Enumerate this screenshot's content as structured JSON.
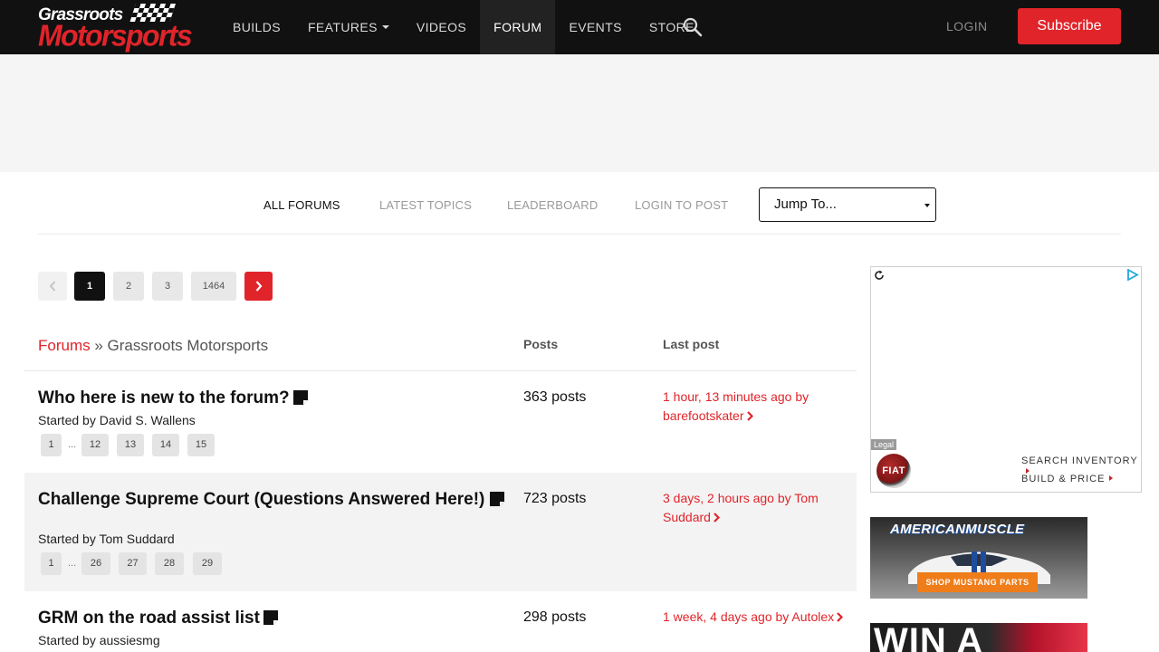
{
  "site": {
    "logo_line1": "Grassroots",
    "logo_line2": "Motorsports"
  },
  "nav": {
    "items": [
      {
        "label": "BUILDS"
      },
      {
        "label": "FEATURES"
      },
      {
        "label": "VIDEOS"
      },
      {
        "label": "FORUM"
      },
      {
        "label": "EVENTS"
      },
      {
        "label": "STORE"
      }
    ],
    "login_label": "LOGIN",
    "subscribe_label": "Subscribe"
  },
  "forum_nav": {
    "all_forums": "ALL FORUMS",
    "latest_topics": "LATEST TOPICS",
    "leaderboard": "LEADERBOARD",
    "login_to_post": "LOGIN TO POST",
    "jump_to": "Jump To..."
  },
  "pagination": {
    "pages": [
      "1",
      "2",
      "3",
      "1464"
    ],
    "current": "1"
  },
  "table": {
    "breadcrumb_link": "Forums",
    "breadcrumb_sep": " » ",
    "breadcrumb_current": "Grassroots Motorsports",
    "col_posts": "Posts",
    "col_last_post": "Last post"
  },
  "topics": [
    {
      "title": "Who here is new to the forum?",
      "started_by": "Started by David S. Wallens",
      "pages": [
        "1",
        "...",
        "12",
        "13",
        "14",
        "15"
      ],
      "posts": "363 posts",
      "last_post": "1 hour, 13 minutes ago by barefootskater"
    },
    {
      "title": "Challenge Supreme Court (Questions Answered Here!)",
      "started_by": "Started by Tom Suddard",
      "pages": [
        "1",
        "...",
        "26",
        "27",
        "28",
        "29"
      ],
      "posts": "723 posts",
      "last_post": "3 days, 2 hours ago by Tom Suddard"
    },
    {
      "title": "GRM on the road assist list",
      "started_by": "Started by aussiesmg",
      "pages": [],
      "posts": "298 posts",
      "last_post": "1 week, 4 days ago by Autolex"
    }
  ],
  "ads": {
    "legal": "Legal",
    "fiat_logo": "FIAT",
    "search_inventory": "SEARCH INVENTORY",
    "build_price": "BUILD & PRICE",
    "am_brand": "AMERICANMUSCLE",
    "am_button": "SHOP MUSTANG PARTS",
    "win_text": "WIN A"
  },
  "colors": {
    "brand_red": "#e0242a",
    "nav_bg": "#111111"
  }
}
